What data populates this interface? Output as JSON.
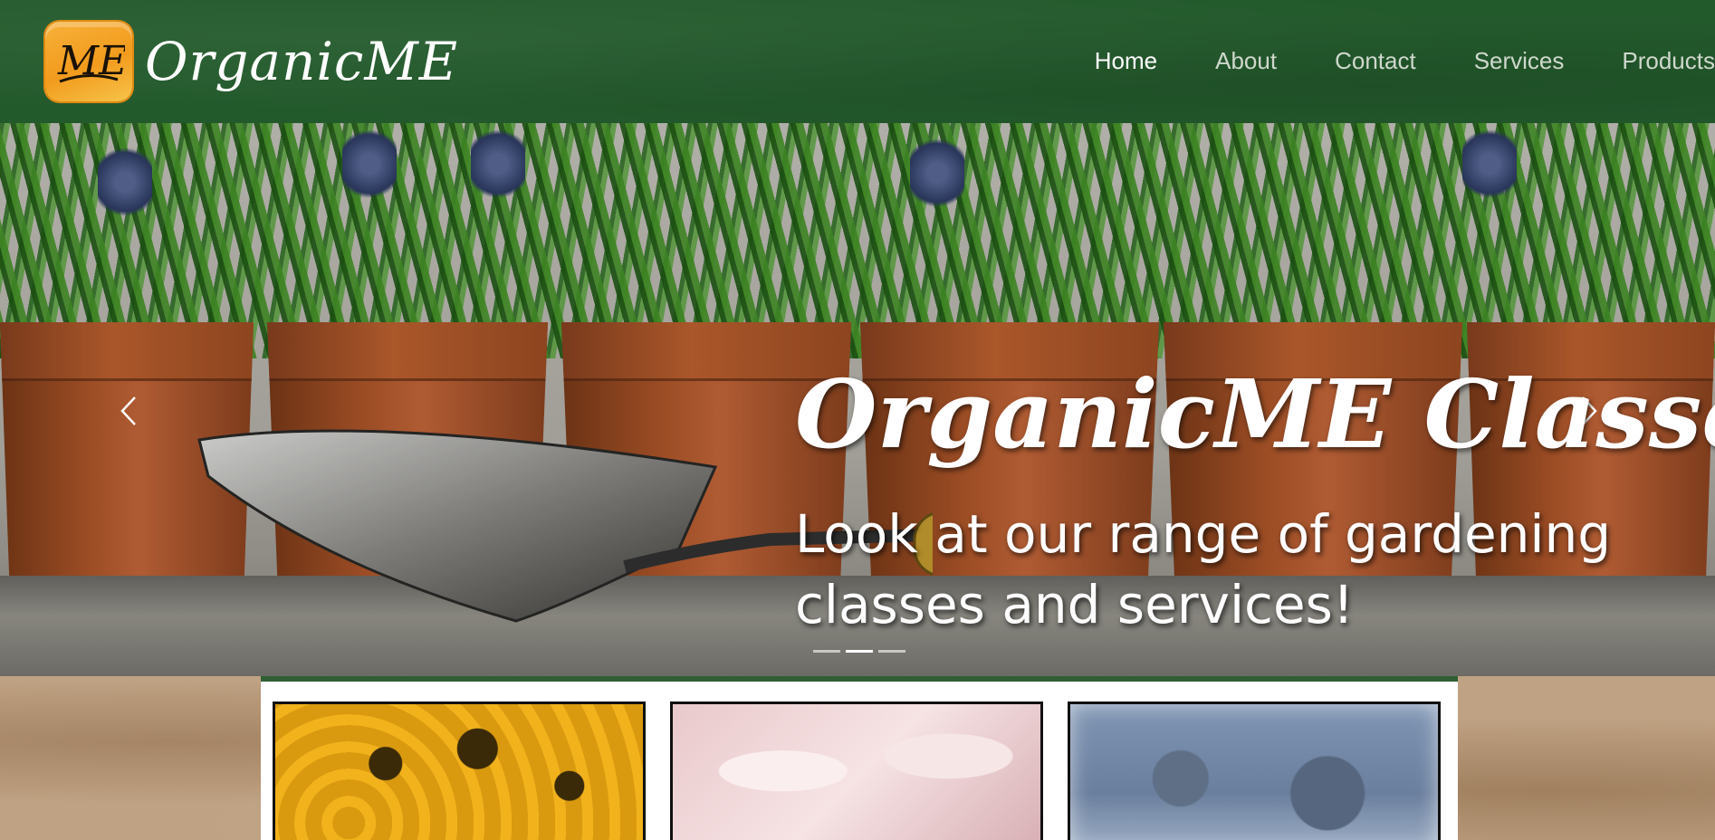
{
  "header": {
    "logo_mark": "ME",
    "brand_name": "OrganicME",
    "nav": [
      {
        "label": "Home",
        "active": true
      },
      {
        "label": "About",
        "active": false
      },
      {
        "label": "Contact",
        "active": false
      },
      {
        "label": "Services",
        "active": false
      },
      {
        "label": "Products",
        "active": false
      }
    ]
  },
  "hero": {
    "title": "OrganicME Classes",
    "text": "Look at our range of gardening classes and services!",
    "prev_icon": "chevron-left-icon",
    "next_icon": "chevron-right-icon",
    "slides_total": 3,
    "active_slide": 2
  },
  "cards": [
    {
      "image": "honeycomb-bees"
    },
    {
      "image": "pink-marshmallows"
    },
    {
      "image": "blue-flowers"
    }
  ],
  "colors": {
    "header_green": "#235a2c",
    "panel_border": "#2f5f33",
    "logo_orange": "#f29b1d",
    "nav_active": "#ffffff",
    "nav_inactive": "#cfd8cc"
  }
}
